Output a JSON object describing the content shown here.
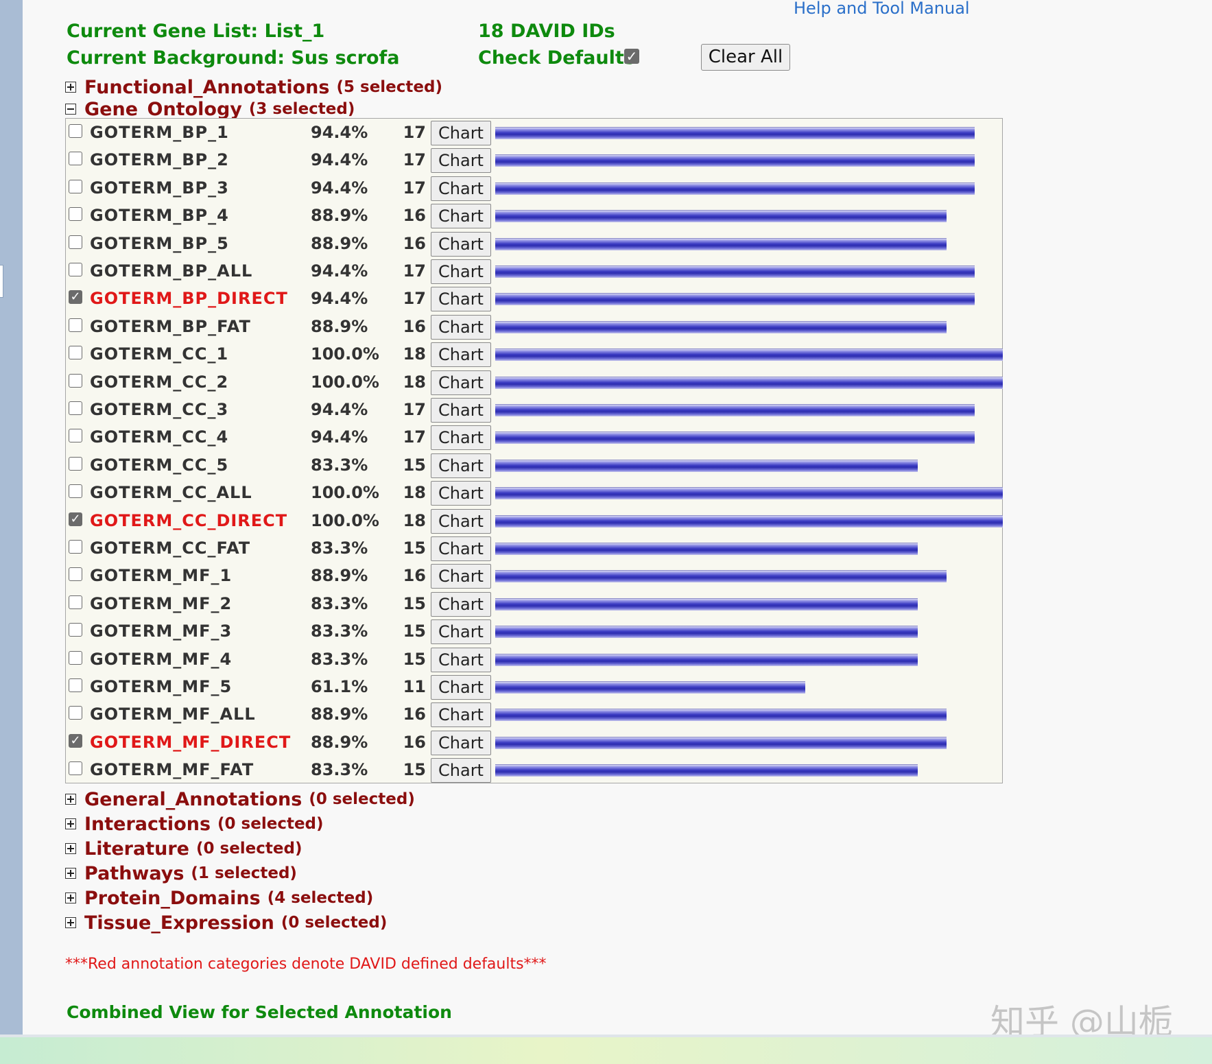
{
  "header": {
    "help_link": "Help and Tool Manual",
    "gene_list": "Current Gene List: List_1",
    "background": "Current Background: Sus scrofa",
    "david_ids": "18 DAVID IDs",
    "check_defaults": "Check Defaults",
    "check_defaults_checked": true,
    "clear_all": "Clear All"
  },
  "categories_top": [
    {
      "name": "Functional_Annotations",
      "count": "(5 selected)",
      "expanded": false
    },
    {
      "name": "Gene_Ontology",
      "count": "(3 selected)",
      "expanded": true
    }
  ],
  "chart_button_label": "Chart",
  "check_mark": "✓",
  "terms": [
    {
      "name": "GOTERM_BP_1",
      "pct": "94.4%",
      "count": "17",
      "fraction": 0.944,
      "checked": false,
      "default": false
    },
    {
      "name": "GOTERM_BP_2",
      "pct": "94.4%",
      "count": "17",
      "fraction": 0.944,
      "checked": false,
      "default": false
    },
    {
      "name": "GOTERM_BP_3",
      "pct": "94.4%",
      "count": "17",
      "fraction": 0.944,
      "checked": false,
      "default": false
    },
    {
      "name": "GOTERM_BP_4",
      "pct": "88.9%",
      "count": "16",
      "fraction": 0.889,
      "checked": false,
      "default": false
    },
    {
      "name": "GOTERM_BP_5",
      "pct": "88.9%",
      "count": "16",
      "fraction": 0.889,
      "checked": false,
      "default": false
    },
    {
      "name": "GOTERM_BP_ALL",
      "pct": "94.4%",
      "count": "17",
      "fraction": 0.944,
      "checked": false,
      "default": false
    },
    {
      "name": "GOTERM_BP_DIRECT",
      "pct": "94.4%",
      "count": "17",
      "fraction": 0.944,
      "checked": true,
      "default": true
    },
    {
      "name": "GOTERM_BP_FAT",
      "pct": "88.9%",
      "count": "16",
      "fraction": 0.889,
      "checked": false,
      "default": false
    },
    {
      "name": "GOTERM_CC_1",
      "pct": "100.0%",
      "count": "18",
      "fraction": 1.0,
      "checked": false,
      "default": false
    },
    {
      "name": "GOTERM_CC_2",
      "pct": "100.0%",
      "count": "18",
      "fraction": 1.0,
      "checked": false,
      "default": false
    },
    {
      "name": "GOTERM_CC_3",
      "pct": "94.4%",
      "count": "17",
      "fraction": 0.944,
      "checked": false,
      "default": false
    },
    {
      "name": "GOTERM_CC_4",
      "pct": "94.4%",
      "count": "17",
      "fraction": 0.944,
      "checked": false,
      "default": false
    },
    {
      "name": "GOTERM_CC_5",
      "pct": "83.3%",
      "count": "15",
      "fraction": 0.833,
      "checked": false,
      "default": false
    },
    {
      "name": "GOTERM_CC_ALL",
      "pct": "100.0%",
      "count": "18",
      "fraction": 1.0,
      "checked": false,
      "default": false
    },
    {
      "name": "GOTERM_CC_DIRECT",
      "pct": "100.0%",
      "count": "18",
      "fraction": 1.0,
      "checked": true,
      "default": true
    },
    {
      "name": "GOTERM_CC_FAT",
      "pct": "83.3%",
      "count": "15",
      "fraction": 0.833,
      "checked": false,
      "default": false
    },
    {
      "name": "GOTERM_MF_1",
      "pct": "88.9%",
      "count": "16",
      "fraction": 0.889,
      "checked": false,
      "default": false
    },
    {
      "name": "GOTERM_MF_2",
      "pct": "83.3%",
      "count": "15",
      "fraction": 0.833,
      "checked": false,
      "default": false
    },
    {
      "name": "GOTERM_MF_3",
      "pct": "83.3%",
      "count": "15",
      "fraction": 0.833,
      "checked": false,
      "default": false
    },
    {
      "name": "GOTERM_MF_4",
      "pct": "83.3%",
      "count": "15",
      "fraction": 0.833,
      "checked": false,
      "default": false
    },
    {
      "name": "GOTERM_MF_5",
      "pct": "61.1%",
      "count": "11",
      "fraction": 0.611,
      "checked": false,
      "default": false
    },
    {
      "name": "GOTERM_MF_ALL",
      "pct": "88.9%",
      "count": "16",
      "fraction": 0.889,
      "checked": false,
      "default": false
    },
    {
      "name": "GOTERM_MF_DIRECT",
      "pct": "88.9%",
      "count": "16",
      "fraction": 0.889,
      "checked": true,
      "default": true
    },
    {
      "name": "GOTERM_MF_FAT",
      "pct": "83.3%",
      "count": "15",
      "fraction": 0.833,
      "checked": false,
      "default": false
    }
  ],
  "categories_bottom": [
    {
      "name": "General_Annotations",
      "count": "(0 selected)",
      "expanded": false
    },
    {
      "name": "Interactions",
      "count": "(0 selected)",
      "expanded": false
    },
    {
      "name": "Literature",
      "count": "(0 selected)",
      "expanded": false
    },
    {
      "name": "Pathways",
      "count": "(1 selected)",
      "expanded": false
    },
    {
      "name": "Protein_Domains",
      "count": "(4 selected)",
      "expanded": false
    },
    {
      "name": "Tissue_Expression",
      "count": "(0 selected)",
      "expanded": false
    }
  ],
  "footnote": "***Red annotation categories denote DAVID defined defaults***",
  "combined_view": "Combined View for Selected Annotation",
  "watermark": "知乎 @山栀",
  "colors": {
    "green_text": "#0e8a0e",
    "category_text": "#8b0e0e",
    "default_term": "#e01818",
    "bar": "#2e2eb0",
    "link": "#2a6fc9"
  }
}
